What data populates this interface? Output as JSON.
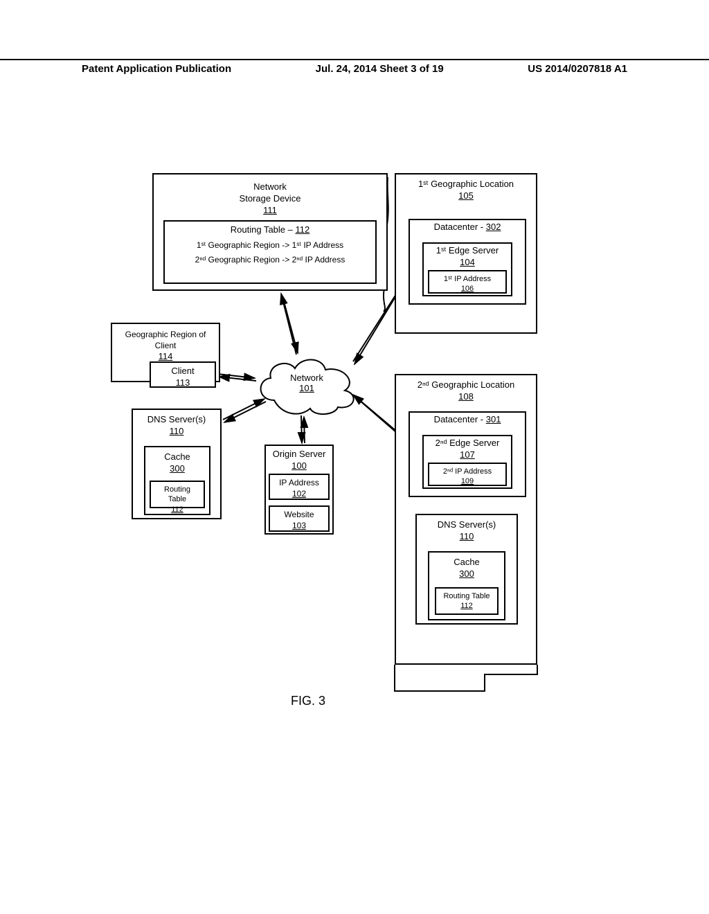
{
  "header": {
    "left": "Patent Application Publication",
    "center": "Jul. 24, 2014  Sheet 3 of 19",
    "right": "US 2014/0207818 A1"
  },
  "figure_label": "FIG. 3",
  "cloud": {
    "label": "Network",
    "num": "101"
  },
  "storage": {
    "label": "Network\nStorage Device",
    "num": "111",
    "routing": {
      "label": "Routing Table –",
      "num": "112",
      "row1": "1ˢᵗ Geographic Region -> 1ˢᵗ IP Address",
      "row2": "2ⁿᵈ Geographic Region -> 2ⁿᵈ IP Address"
    }
  },
  "client_region": {
    "label": "Geographic Region of Client",
    "num": "114",
    "client": {
      "label": "Client",
      "num": "113"
    }
  },
  "dns_left": {
    "label": "DNS Server(s)",
    "num": "110",
    "cache": {
      "label": "Cache",
      "num": "300",
      "routing": {
        "label": "Routing Table",
        "num": "112"
      }
    }
  },
  "origin": {
    "label": "Origin Server",
    "num": "100",
    "ip": {
      "label": "IP Address",
      "num": "102"
    },
    "site": {
      "label": "Website",
      "num": "103"
    }
  },
  "geo1": {
    "label": "1ˢᵗ Geographic Location",
    "num": "105",
    "dc": {
      "label": "Datacenter -",
      "num": "302",
      "edge": {
        "label": "1ˢᵗ Edge Server",
        "num": "104",
        "ip": {
          "label": "1ˢᵗ IP Address",
          "num": "106"
        }
      }
    }
  },
  "geo2": {
    "label": "2ⁿᵈ Geographic Location",
    "num": "108",
    "dc": {
      "label": "Datacenter -",
      "num": "301",
      "edge": {
        "label": "2ⁿᵈ Edge Server",
        "num": "107",
        "ip": {
          "label": "2ⁿᵈ IP Address",
          "num": "109"
        }
      }
    },
    "dns": {
      "label": "DNS Server(s)",
      "num": "110",
      "cache": {
        "label": "Cache",
        "num": "300",
        "routing": {
          "label": "Routing Table",
          "num": "112"
        }
      }
    }
  }
}
